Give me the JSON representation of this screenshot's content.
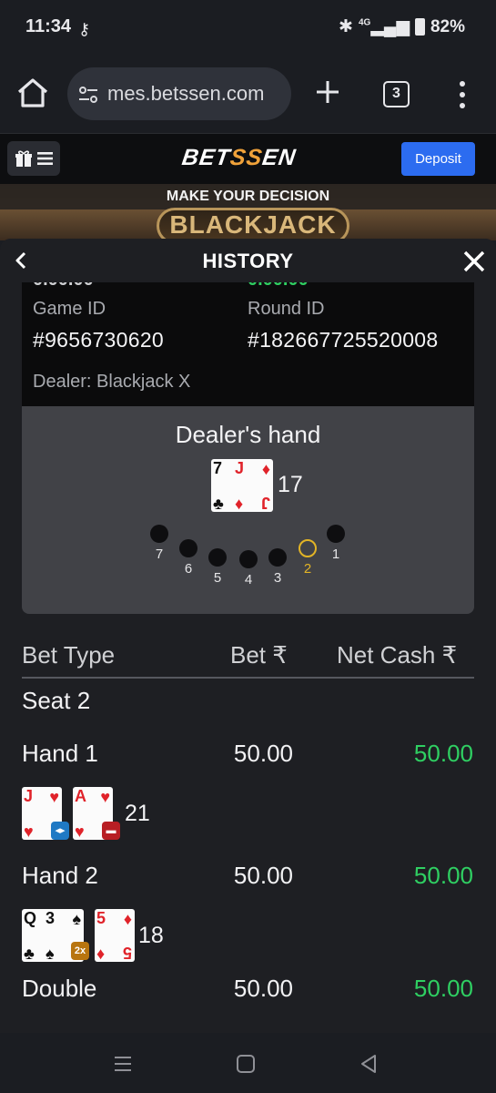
{
  "status_bar": {
    "time": "11:34",
    "network": "4G",
    "battery": "82%"
  },
  "browser": {
    "url": "mes.betssen.com",
    "tab_count": "3"
  },
  "site": {
    "logo_left": "BET",
    "logo_mid": "SS",
    "logo_right": "EN",
    "deposit_label": "Deposit"
  },
  "game_banner": {
    "prompt": "MAKE YOUR DECISION",
    "title": "BLACKJACK"
  },
  "history": {
    "title": "HISTORY",
    "cut_left": "0.00.00",
    "cut_right": "0.00.00",
    "game_id_label": "Game ID",
    "game_id": "#9656730620",
    "round_id_label": "Round ID",
    "round_id": "#182667725520008",
    "dealer_label": "Dealer: Blackjack X",
    "dealer_hand_title": "Dealer's hand",
    "dealer_cards": [
      {
        "rank": "7",
        "suit": "♣",
        "color": "black"
      },
      {
        "rank": "J",
        "suit": "♦",
        "color": "red"
      }
    ],
    "dealer_total": "17",
    "seats": [
      "7",
      "6",
      "5",
      "4",
      "3",
      "2",
      "1"
    ],
    "active_seat": "2",
    "table": {
      "col_bet_type": "Bet Type",
      "col_bet": "Bet ₹",
      "col_net_cash": "Net Cash ₹",
      "seat_label": "Seat 2",
      "rows": [
        {
          "label": "Hand 1",
          "bet": "50.00",
          "net": "50.00"
        },
        {
          "label": "Hand 2",
          "bet": "50.00",
          "net": "50.00"
        },
        {
          "label": "Double",
          "bet": "50.00",
          "net": "50.00"
        }
      ],
      "hand1_cards": [
        {
          "rank": "J",
          "suit": "♥",
          "color": "red"
        },
        {
          "rank": "A",
          "suit": "♥",
          "color": "red"
        }
      ],
      "hand1_total": "21",
      "hand2_cards": [
        {
          "rank": "Q",
          "suit": "♣",
          "color": "black"
        },
        {
          "rank": "3",
          "suit": "♠",
          "color": "black"
        },
        {
          "rank": "5",
          "suit": "♦",
          "color": "red"
        }
      ],
      "hand2_total": "18",
      "double_badge": "2x"
    }
  },
  "colors": {
    "accent": "#2c6cf0",
    "win": "#2fcf62",
    "active_seat": "#e2b426"
  }
}
